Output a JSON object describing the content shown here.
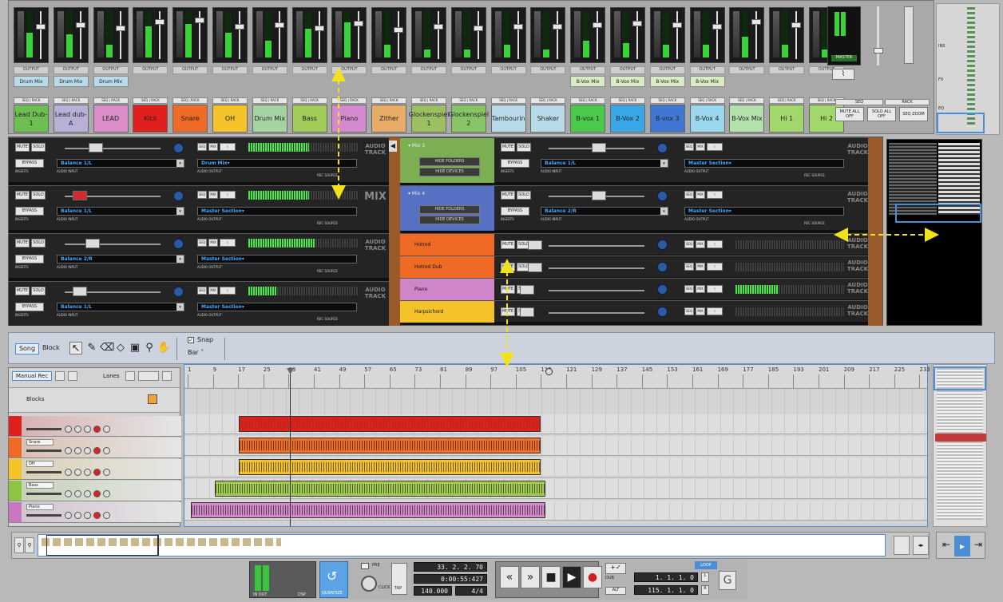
{
  "mixer": {
    "output_label": "OUTPUT",
    "mix_tags": [
      "Drum Mix",
      "Drum Mix",
      "Drum Mix",
      "",
      "",
      "",
      "",
      "",
      "",
      "",
      "",
      "",
      "",
      "",
      "B-Vox Mix",
      "B-Vox Mix",
      "B-Vox Mix",
      "B-Vox Mix",
      "",
      "",
      "",
      ""
    ],
    "channels": [
      {
        "name": "Lead Dub-1",
        "color": "#6dbf52"
      },
      {
        "name": "Lead dub-A",
        "color": "#b9b0d8"
      },
      {
        "name": "LEAD",
        "color": "#d98ec8"
      },
      {
        "name": "Kick",
        "color": "#e0201f"
      },
      {
        "name": "Snare",
        "color": "#ef6a24"
      },
      {
        "name": "OH",
        "color": "#f5c22a"
      },
      {
        "name": "Drum Mix",
        "color": "#a5d3a1"
      },
      {
        "name": "Bass",
        "color": "#a0cc57"
      },
      {
        "name": "Piano",
        "color": "#d58ad0"
      },
      {
        "name": "Zither",
        "color": "#e7ad68"
      },
      {
        "name": "Glockenspiel 1",
        "color": "#9cbf62"
      },
      {
        "name": "Glockenspiel 2",
        "color": "#86c466"
      },
      {
        "name": "Tambourin",
        "color": "#b9dbe9"
      },
      {
        "name": "Shaker",
        "color": "#b9dbe9"
      },
      {
        "name": "B-vox 1",
        "color": "#4bc94b"
      },
      {
        "name": "B-Vox 2",
        "color": "#3aa7e8"
      },
      {
        "name": "B-vox 3",
        "color": "#3f77d3"
      },
      {
        "name": "B-Vox 4",
        "color": "#9cd7f0"
      },
      {
        "name": "B-Vox Mix",
        "color": "#b4e0a9"
      },
      {
        "name": "Hi 1",
        "color": "#a2d76b"
      },
      {
        "name": "Hi 2",
        "color": "#a2d76b"
      }
    ],
    "send_labels": [
      "SEQ",
      "RACK"
    ],
    "master": {
      "seq_label": "SEQ",
      "rack_label": "RACK",
      "buttons": [
        "MUTE ALL OFF",
        "SOLO ALL OFF",
        "SEQ ZOOM"
      ]
    },
    "fold_labels": [
      "INS",
      "FX",
      "EQ"
    ]
  },
  "rack": {
    "mute": "MUTE",
    "solo": "SOLO",
    "bypass": "BYPASS",
    "inserts": "INSERTS",
    "seq_rack": [
      "SEQ",
      "MIX"
    ],
    "audio_input": "AUDIO INPUT",
    "audio_output": "AUDIO OUTPUT",
    "rec_source": "REC SOURCE",
    "audio_track": "AUDIO TRACK",
    "mix_label": "MIX",
    "left_devices": [
      {
        "balance": "Balance 1/L",
        "output": "Drum Mix"
      },
      {
        "balance": "Balance 1/L",
        "output": "Master Section"
      },
      {
        "balance": "Balance 2/R",
        "output": "Master Section"
      },
      {
        "balance": "Balance 1/L",
        "output": "Master Section"
      }
    ],
    "right_groups": [
      {
        "name": "Mix 3",
        "color": "#7cae52",
        "hide1": "HIDE FOLDERS",
        "hide2": "HIDE DEVICES",
        "balance": "Balance 1/L",
        "output": "Master Section"
      },
      {
        "name": "Mix 4",
        "color": "#5670c4",
        "hide1": "HIDE FOLDERS",
        "hide2": "HIDE DEVICES",
        "balance": "Balance 2/R",
        "output": "Master Section"
      }
    ],
    "right_tracks": [
      {
        "name": "Hotrod",
        "color": "#ef6a24"
      },
      {
        "name": "Hotrod Dub",
        "color": "#ef6a24"
      },
      {
        "name": "Piano",
        "color": "#cf86c9"
      },
      {
        "name": "Harpsichord",
        "color": "#f5c22a"
      }
    ]
  },
  "toolbar": {
    "song": "Song",
    "block": "Block",
    "snap": "Snap",
    "snap_value": "Bar"
  },
  "seq": {
    "manual_rec": "Manual Rec",
    "lanes": "Lanes",
    "blocks": "Blocks",
    "ruler": [
      "1",
      "9",
      "17",
      "25",
      "33",
      "41",
      "49",
      "57",
      "65",
      "73",
      "81",
      "89",
      "97",
      "105",
      "113",
      "121",
      "129",
      "137",
      "145",
      "153",
      "161",
      "169",
      "177",
      "185",
      "193",
      "201",
      "209",
      "217",
      "225",
      "233"
    ],
    "tracks": [
      {
        "name": "",
        "color": "#e0201f",
        "clip_color": "#d6231d"
      },
      {
        "name": "Snare",
        "color": "#ef6a24",
        "clip_color": "#f07020"
      },
      {
        "name": "OH",
        "color": "#f5c22a",
        "clip_color": "#f3c12d"
      },
      {
        "name": "Bass",
        "color": "#8cc542",
        "clip_color": "#a4cc55"
      },
      {
        "name": "Piano",
        "color": "#c878bf",
        "clip_color": "#d28ac8"
      }
    ]
  },
  "transport": {
    "pos_bars": "33. 2. 2. 70",
    "pos_time": "0:00:55:427",
    "tempo": "140.000",
    "signature": "4/4",
    "loop_left": "1. 1. 1. 0",
    "loop_right": "115. 1. 1. 0",
    "loop_label": "LOOP",
    "click_label": "CLICK",
    "tap_label": "TAP",
    "dsp_label": "DSP",
    "in_out": "IN OUT",
    "pre_label": "PRE",
    "quantize_label": "QUANTIZE",
    "dub": "DUB",
    "alt": "ALT"
  },
  "colors": {
    "accent": "#4a8fd6",
    "arrow": "#f2e21c"
  }
}
